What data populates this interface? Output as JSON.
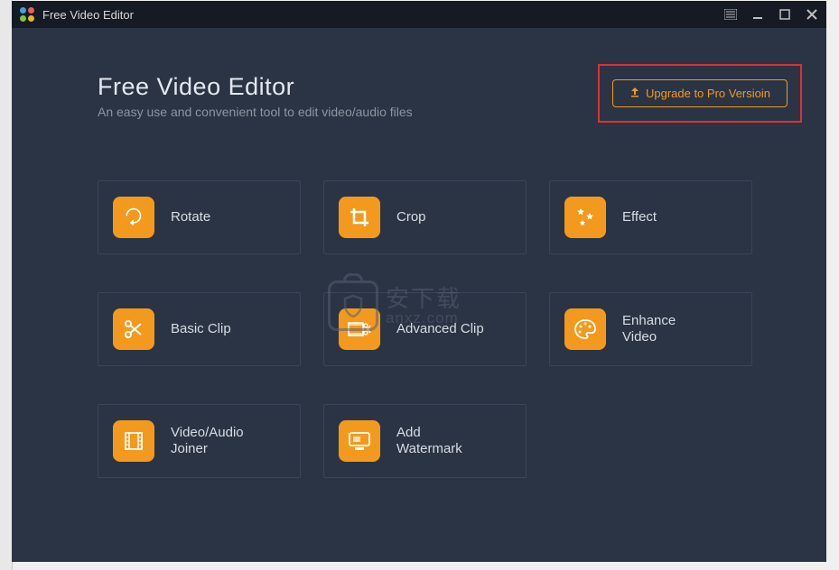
{
  "titlebar": {
    "app_name": "Free Video Editor"
  },
  "header": {
    "title": "Free Video Editor",
    "subtitle": "An easy use and convenient tool to edit video/audio files"
  },
  "upgrade": {
    "label": "Upgrade to Pro Versioin"
  },
  "tools": [
    {
      "id": "rotate",
      "label": "Rotate"
    },
    {
      "id": "crop",
      "label": "Crop"
    },
    {
      "id": "effect",
      "label": "Effect"
    },
    {
      "id": "basic-clip",
      "label": "Basic Clip"
    },
    {
      "id": "advanced-clip",
      "label": "Advanced Clip"
    },
    {
      "id": "enhance-video",
      "label": "Enhance\nVideo"
    },
    {
      "id": "video-audio-joiner",
      "label": "Video/Audio\nJoiner"
    },
    {
      "id": "add-watermark",
      "label": "Add\nWatermark"
    }
  ],
  "watermark": {
    "cn": "安下载",
    "en": "anxz.com"
  },
  "colors": {
    "accent": "#f39a1e",
    "window_bg": "#2a3444",
    "titlebar_bg": "#151a24",
    "highlight_border": "#e03030"
  }
}
